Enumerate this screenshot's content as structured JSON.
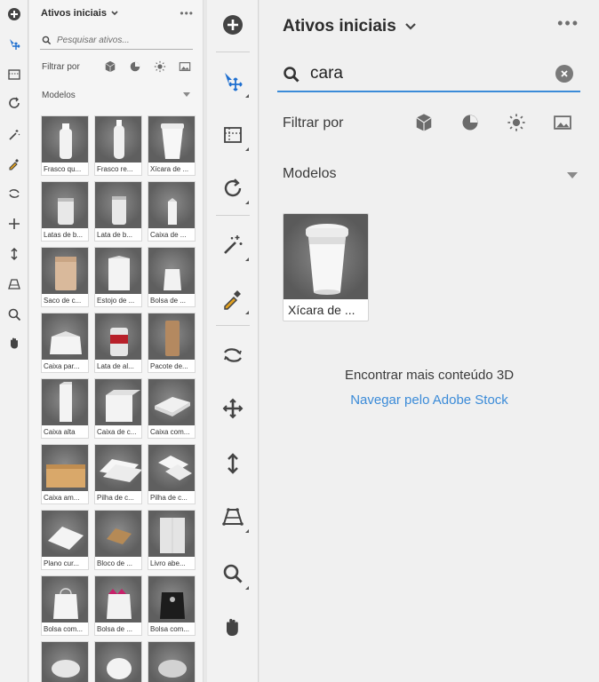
{
  "small_panel": {
    "title": "Ativos iniciais",
    "more": "•••",
    "search_placeholder": "Pesquisar ativos...",
    "filter_label": "Filtrar por",
    "models_label": "Modelos",
    "items": [
      {
        "label": "Frasco qu..."
      },
      {
        "label": "Frasco re..."
      },
      {
        "label": "Xícara de ..."
      },
      {
        "label": "Latas de b..."
      },
      {
        "label": "Lata de b..."
      },
      {
        "label": "Caixa de ..."
      },
      {
        "label": "Saco de c..."
      },
      {
        "label": "Estojo de ..."
      },
      {
        "label": "Bolsa de ..."
      },
      {
        "label": "Caixa par..."
      },
      {
        "label": "Lata de al..."
      },
      {
        "label": "Pacote de..."
      },
      {
        "label": "Caixa alta"
      },
      {
        "label": "Caixa de c..."
      },
      {
        "label": "Caixa com..."
      },
      {
        "label": "Caixa am..."
      },
      {
        "label": "Pilha de c..."
      },
      {
        "label": "Pilha de c..."
      },
      {
        "label": "Plano cur..."
      },
      {
        "label": "Bloco de ..."
      },
      {
        "label": "Livro abe..."
      },
      {
        "label": "Bolsa com..."
      },
      {
        "label": "Bolsa de ..."
      },
      {
        "label": "Bolsa com..."
      },
      {
        "label": ""
      },
      {
        "label": ""
      },
      {
        "label": ""
      }
    ]
  },
  "large_panel": {
    "title": "Ativos iniciais",
    "more": "•••",
    "search_value": "cara",
    "filter_label": "Filtrar por",
    "models_label": "Modelos",
    "result": {
      "label": "Xícara de ..."
    },
    "more_content": "Encontrar mais conteúdo 3D",
    "stock_link": "Navegar pelo Adobe Stock"
  },
  "colors": {
    "accent": "#3b8bd8",
    "panel_bg": "#f0f0f0",
    "thumb_bg": "#6a6a6a"
  }
}
